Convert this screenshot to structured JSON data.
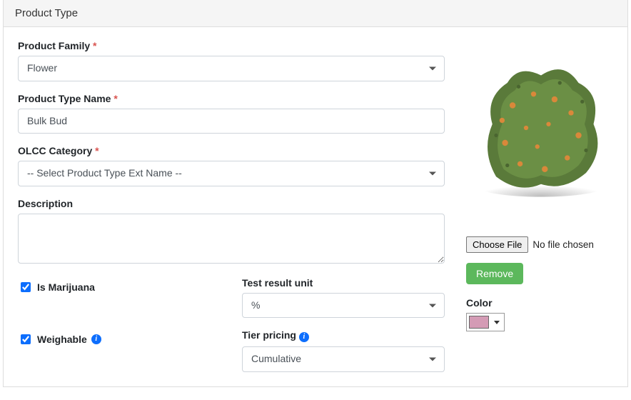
{
  "panel": {
    "title": "Product Type"
  },
  "form": {
    "productFamily": {
      "label": "Product Family",
      "required": "*",
      "value": "Flower"
    },
    "productTypeName": {
      "label": "Product Type Name",
      "required": "*",
      "value": "Bulk Bud"
    },
    "olccCategory": {
      "label": "OLCC Category",
      "required": "*",
      "value": "-- Select Product Type Ext Name --"
    },
    "description": {
      "label": "Description",
      "value": ""
    },
    "isMarijuana": {
      "label": "Is Marijuana",
      "checked": true
    },
    "testResultUnit": {
      "label": "Test result unit",
      "value": "%"
    },
    "weighable": {
      "label": "Weighable",
      "checked": true
    },
    "tierPricing": {
      "label": "Tier pricing",
      "value": "Cumulative"
    }
  },
  "rightCol": {
    "chooseFile": "Choose File",
    "fileStatus": "No file chosen",
    "remove": "Remove",
    "colorLabel": "Color",
    "colorValue": "#d49bb5"
  },
  "icons": {
    "info": "i"
  }
}
